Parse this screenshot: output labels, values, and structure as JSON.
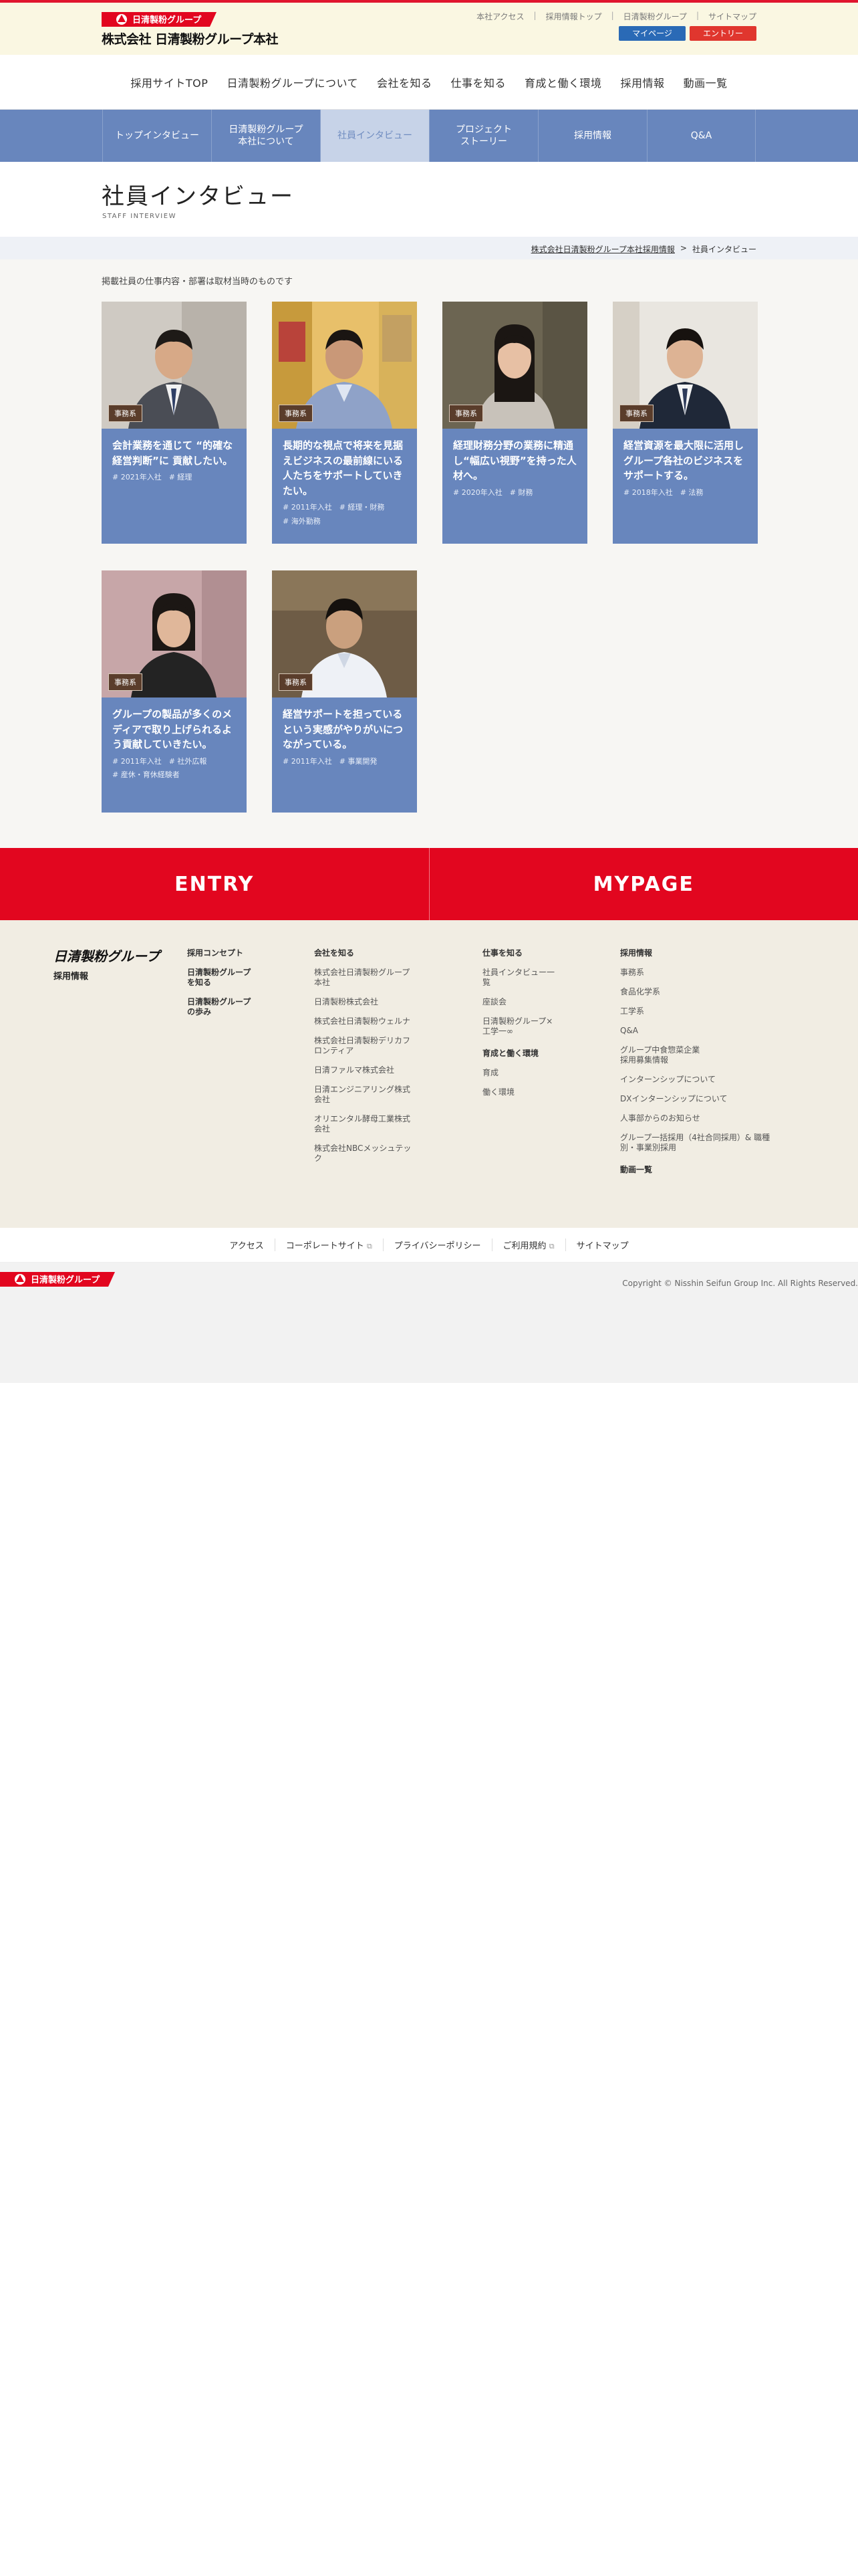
{
  "header": {
    "logo_badge_text": "日清製粉グループ",
    "company_name": "株式会社 日清製粉グループ本社",
    "top_links": [
      "本社アクセス",
      "採用情報トップ",
      "日清製粉グループ",
      "サイトマップ"
    ],
    "mypage_label": "マイページ",
    "entry_label": "エントリー",
    "global_nav": [
      "採用サイトTOP",
      "日清製粉グループについて",
      "会社を知る",
      "仕事を知る",
      "育成と働く環境",
      "採用情報",
      "動画一覧"
    ]
  },
  "subnav": [
    {
      "label": "トップインタビュー",
      "active": false
    },
    {
      "label": "日清製粉グループ\n本社について",
      "active": false
    },
    {
      "label": "社員インタビュー",
      "active": true
    },
    {
      "label": "プロジェクト\nストーリー",
      "active": false
    },
    {
      "label": "採用情報",
      "active": false
    },
    {
      "label": "Q&A",
      "active": false
    }
  ],
  "page": {
    "title": "社員インタビュー",
    "title_en": "STAFF INTERVIEW",
    "breadcrumb_home": "株式会社日清製粉グループ本社採用情報",
    "breadcrumb_sep": ">",
    "breadcrumb_current": "社員インタビュー",
    "note": "掲載社員の仕事内容・部署は取材当時のものです"
  },
  "cards": [
    {
      "tag": "事務系",
      "title": "会計業務を通じて “的確な経営判断”に 貢献したい。",
      "meta": "# 2021年入社　# 経理"
    },
    {
      "tag": "事務系",
      "title": "長期的な視点で将来を見据えビジネスの最前線にいる人たちをサポートしていきたい。",
      "meta": "# 2011年入社　# 経理・財務\n# 海外勤務"
    },
    {
      "tag": "事務系",
      "title": "経理財務分野の業務に精通し“幅広い視野”を持った人材へ。",
      "meta": "# 2020年入社　# 財務"
    },
    {
      "tag": "事務系",
      "title": "経営資源を最大限に活用しグループ各社のビジネスをサポートする。",
      "meta": "# 2018年入社　# 法務"
    },
    {
      "tag": "事務系",
      "title": "グループの製品が多くのメディアで取り上げられるよう貢献していきたい。",
      "meta": "# 2011年入社　# 社外広報\n# 産休・育休経験者"
    },
    {
      "tag": "事務系",
      "title": "経営サポートを担っているという実感がやりがいにつながっている。",
      "meta": "# 2011年入社　# 事業開発"
    }
  ],
  "entry": {
    "entry_label": "ENTRY",
    "mypage_label": "MYPAGE"
  },
  "footer": {
    "logo_text": "日清製粉グループ",
    "logo_sub": "採用情報",
    "col1": [
      "採用コンセプト",
      "日清製粉グループ\nを知る",
      "日清製粉グループ\nの歩み"
    ],
    "col2_head": "会社を知る",
    "col2": [
      "株式会社日清製粉グループ\n本社",
      "日清製粉株式会社",
      "株式会社日清製粉ウェルナ",
      "株式会社日清製粉デリカフ\nロンティア",
      "日清ファルマ株式会社",
      "日清エンジニアリング株式\n会社",
      "オリエンタル酵母工業株式\n会社",
      "株式会社NBCメッシュテッ\nク"
    ],
    "col3_head": "仕事を知る",
    "col3": [
      "社員インタビュー一\n覧",
      "座談会",
      "日清製粉グループ×\n工学一∞"
    ],
    "col3b_head": "育成と働く環境",
    "col3b": [
      "育成",
      "働く環境"
    ],
    "col4_head": "採用情報",
    "col4": [
      "事務系",
      "食品化学系",
      "工学系",
      "Q&A",
      "グループ中食惣菜企業\n採用募集情報",
      "インターンシップについて",
      "DXインターンシップについて",
      "人事部からのお知らせ",
      "グループ一括採用（4社合同採用）& 職種\n別・事業別採用"
    ],
    "col4_last": "動画一覧"
  },
  "legal": [
    "アクセス",
    "コーポレートサイト",
    "プライバシーポリシー",
    "ご利用規約",
    "サイトマップ"
  ],
  "copyright": "Copyright © Nisshin Seifun Group Inc. All Rights Reserved.",
  "colors": {
    "brand_red": "#e2061f",
    "nav_blue": "#6886bd",
    "mypage_blue": "#2a6ab6"
  }
}
